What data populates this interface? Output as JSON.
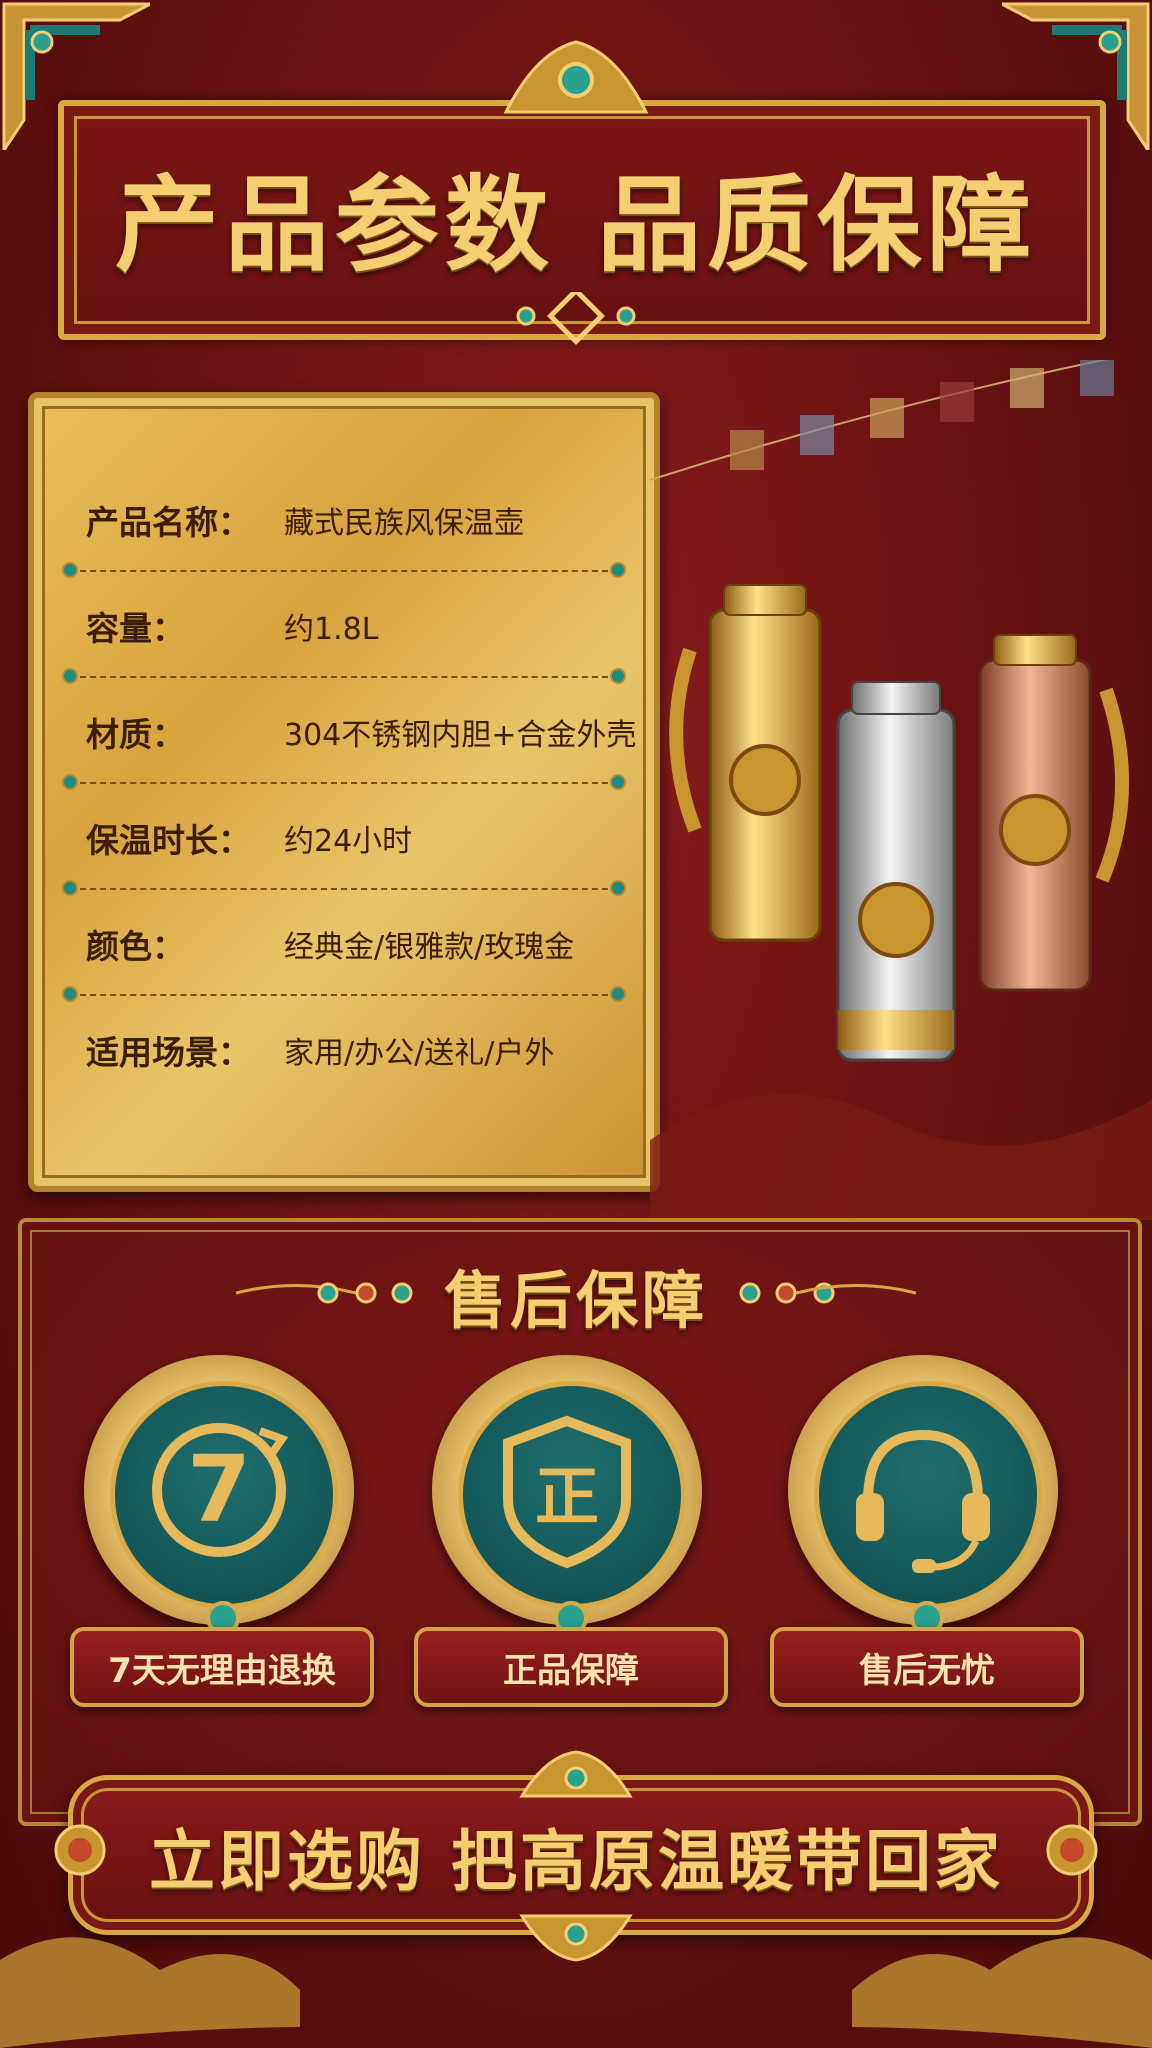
{
  "header": {
    "title": "产品参数 品质保障"
  },
  "specs": [
    {
      "label": "产品名称：",
      "value": "藏式民族风保温壶"
    },
    {
      "label": "容量：",
      "value": "约1.8L"
    },
    {
      "label": "材质：",
      "value": "304不锈钢内胆+合金外壳"
    },
    {
      "label": "保温时长：",
      "value": "约24小时"
    },
    {
      "label": "颜色：",
      "value": "经典金/银雅款/玫瑰金"
    },
    {
      "label": "适用场景：",
      "value": "家用/办公/送礼/户外"
    }
  ],
  "service": {
    "title": "售后保障",
    "badges": [
      {
        "icon": "return-7-days-icon",
        "glyph": "7",
        "label": "7天无理由退换"
      },
      {
        "icon": "shield-icon",
        "glyph": "正",
        "label": "正品保障"
      },
      {
        "icon": "headset-icon",
        "glyph": "",
        "label": "售后无忧"
      }
    ]
  },
  "cta": {
    "label": "立即选购  把高原温暖带回家"
  },
  "colors": {
    "background": "#6b1212",
    "gold": "#d8a940",
    "teal": "#0e4b4d",
    "card": "#e0b14f"
  }
}
